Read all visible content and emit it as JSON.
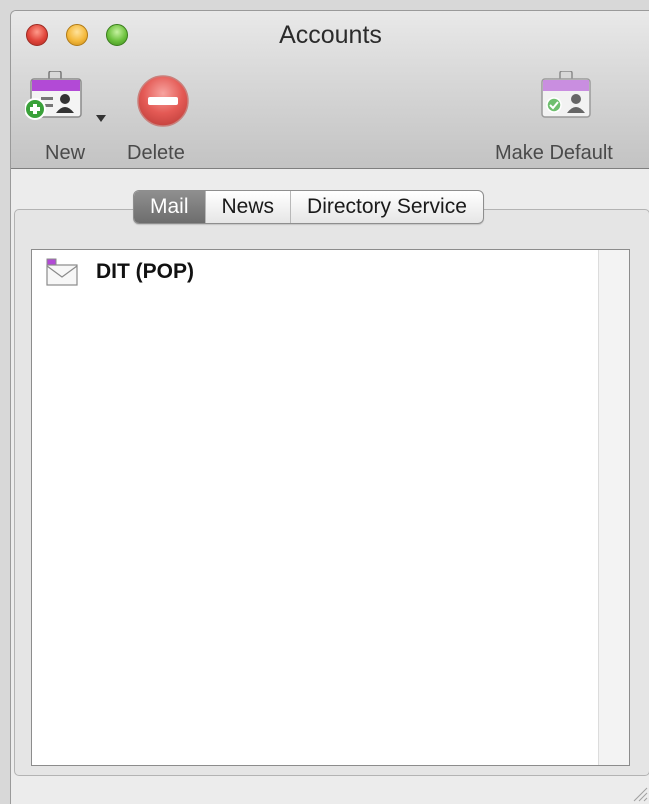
{
  "window": {
    "title": "Accounts"
  },
  "toolbar": {
    "new_label": "New",
    "delete_label": "Delete",
    "make_default_label": "Make Default",
    "new_icon": "id-card-add-icon",
    "delete_icon": "delete-circle-icon",
    "make_default_icon": "id-card-check-icon"
  },
  "tabs": [
    {
      "label": "Mail",
      "selected": true
    },
    {
      "label": "News",
      "selected": false
    },
    {
      "label": "Directory Service",
      "selected": false
    }
  ],
  "accounts": [
    {
      "name": "DIT (POP)",
      "icon": "mail-account-icon"
    }
  ],
  "colors": {
    "accent_purple": "#b24ad6",
    "delete_red": "#e45a55",
    "add_green": "#3aa13a"
  }
}
